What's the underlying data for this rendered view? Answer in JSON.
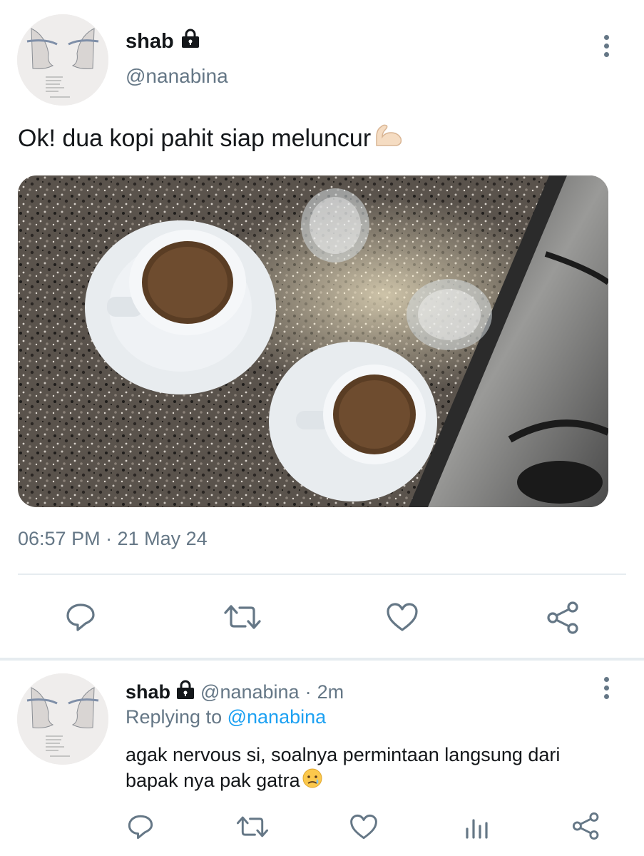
{
  "main_tweet": {
    "author_name": "shab",
    "lock_icon": "lock-icon",
    "handle": "@nanabina",
    "text": "Ok! dua kopi pahit siap meluncur",
    "text_emoji": "💪🏻",
    "timestamp": "06:57 PM · 21 May 24",
    "actions": [
      "reply-icon",
      "retweet-icon",
      "like-icon",
      "share-icon"
    ]
  },
  "reply_tweet": {
    "author_name": "shab",
    "handle": "@nanabina",
    "separator": "·",
    "time": "2m",
    "replying_prefix": "Replying to",
    "replying_to": "@nanabina",
    "text": "agak nervous si, soalnya permintaan langsung dari bapak nya pak gatra",
    "text_emoji": "😥",
    "actions": [
      "reply-icon",
      "retweet-icon",
      "like-icon",
      "analytics-icon",
      "share-icon"
    ]
  },
  "colors": {
    "text": "#14171a",
    "muted": "#657786",
    "link": "#1da1f2",
    "divider": "#e6ecf0"
  }
}
